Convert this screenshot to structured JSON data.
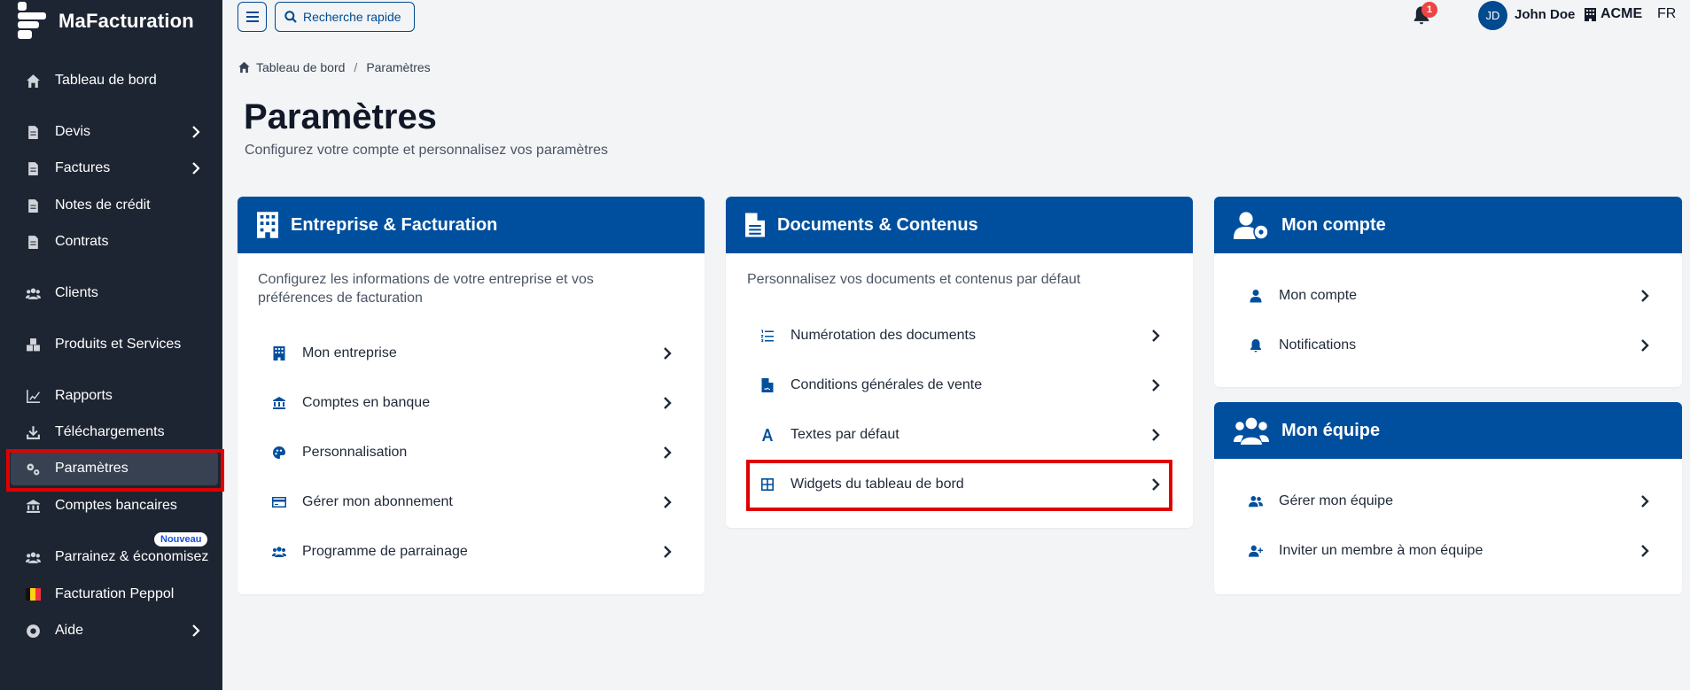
{
  "app": {
    "name": "MaFacturation"
  },
  "sidebar": {
    "items": [
      {
        "label": "Tableau de bord",
        "icon": "home-icon"
      },
      {
        "label": "Devis",
        "icon": "document-icon"
      },
      {
        "label": "Factures",
        "icon": "document-icon"
      },
      {
        "label": "Notes de crédit",
        "icon": "document-icon"
      },
      {
        "label": "Contrats",
        "icon": "document-icon"
      },
      {
        "label": "Clients",
        "icon": "users-icon"
      },
      {
        "label": "Produits et Services",
        "icon": "boxes-icon"
      },
      {
        "label": "Rapports",
        "icon": "chart-icon"
      },
      {
        "label": "Téléchargements",
        "icon": "download-icon"
      },
      {
        "label": "Paramètres",
        "icon": "gears-icon"
      },
      {
        "label": "Comptes bancaires",
        "icon": "bank-icon"
      },
      {
        "label": "Parrainez & économisez",
        "icon": "gift-icon",
        "badge": "Nouveau"
      },
      {
        "label": "Facturation Peppol",
        "icon": "belgium-flag-icon"
      },
      {
        "label": "Aide",
        "icon": "lifebuoy-icon"
      }
    ]
  },
  "topbar": {
    "search_label": "Recherche rapide",
    "notification_count": "1",
    "avatar_initials": "JD",
    "user_name": "John Doe",
    "company": "ACME",
    "language": "FR"
  },
  "breadcrumb": {
    "home": "Tableau de bord",
    "current": "Paramètres"
  },
  "page": {
    "title": "Paramètres",
    "subtitle": "Configurez votre compte et personnalisez vos paramètres"
  },
  "cards": {
    "entreprise": {
      "title": "Entreprise & Facturation",
      "description": "Configurez les informations de votre entreprise et vos préférences de facturation",
      "items": [
        "Mon entreprise",
        "Comptes en banque",
        "Personnalisation",
        "Gérer mon abonnement",
        "Programme de parrainage"
      ]
    },
    "documents": {
      "title": "Documents & Contenus",
      "description": "Personnalisez vos documents et contenus par défaut",
      "items": [
        "Numérotation des documents",
        "Conditions générales de vente",
        "Textes par défaut",
        "Widgets du tableau de bord"
      ]
    },
    "compte": {
      "title": "Mon compte",
      "items": [
        "Mon compte",
        "Notifications"
      ]
    },
    "equipe": {
      "title": "Mon équipe",
      "items": [
        "Gérer mon équipe",
        "Inviter un membre à mon équipe"
      ]
    }
  },
  "colors": {
    "sidebar_bg": "#1e2532",
    "primary": "#004f9e",
    "highlight": "#e00000",
    "badge": "#ef4444"
  }
}
